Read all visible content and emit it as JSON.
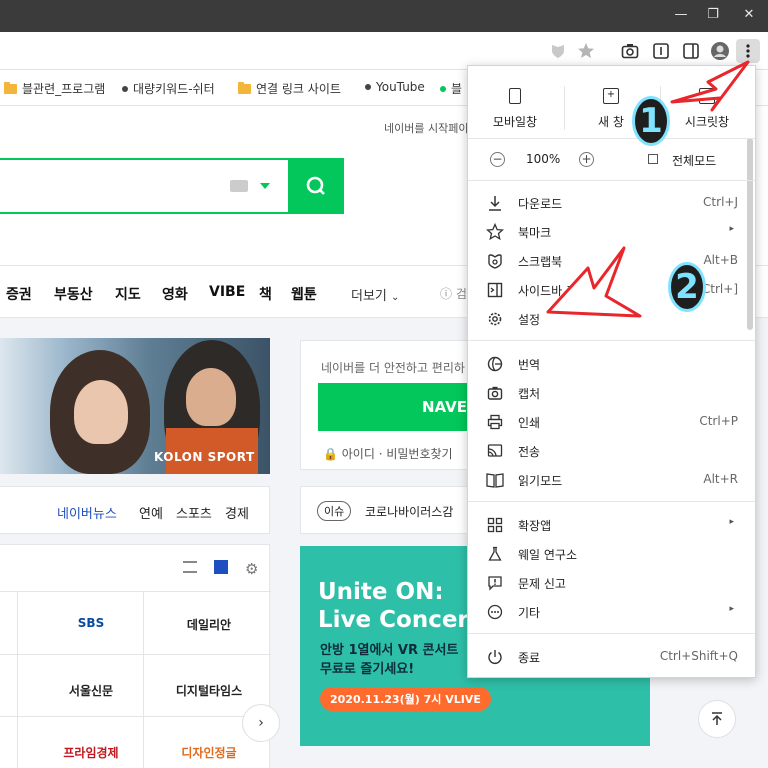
{
  "window": {
    "minimize": "—",
    "maximize": "❐",
    "close": "✕"
  },
  "bookmarks": [
    {
      "label": "블관련_프로그램",
      "type": "folder"
    },
    {
      "label": "대량키워드-쉬터",
      "type": "dot"
    },
    {
      "label": "연결 링크 사이트",
      "type": "folder"
    },
    {
      "label": "YouTube",
      "type": "dot"
    },
    {
      "label": "블",
      "type": "dot-green"
    }
  ],
  "page": {
    "start_text": "네이버를 시작페이",
    "nav": [
      "증권",
      "부동산",
      "지도",
      "영화",
      "VIBE",
      "책",
      "웹툰"
    ],
    "more": "더보기",
    "nav_tail": "검",
    "banner_brand": "KOLON SPORT",
    "login_hint": "네이버를 더 안전하고 편리하",
    "login_button": "NAVE",
    "login_id": "아이디",
    "login_pw": "비밀번호찾기",
    "news_tabs": [
      "네이버뉴스",
      "연예",
      "스포츠",
      "경제"
    ],
    "press": [
      "SBS",
      "데일리안",
      "서울신문",
      "디지털타임스",
      "프라임경제",
      "디자인정글"
    ],
    "issue_badge": "이슈",
    "issue_text": "코로나바이러스감",
    "ad_title": "Unite ON:\nLive Concer",
    "ad_sub": "안방 1열에서 VR 콘서트\n무료로 즐기세요!",
    "ad_pill": "2020.11.23(월) 7시 VLIVE"
  },
  "menu": {
    "top": [
      {
        "label": "모바일창"
      },
      {
        "label": "새 창"
      },
      {
        "label": "시크릿창"
      }
    ],
    "zoom": {
      "value": "100%",
      "minus": "−",
      "plus": "+",
      "fullscreen": "전체모드"
    },
    "group1": [
      {
        "label": "다운로드",
        "shortcut": "Ctrl+J",
        "icon": "download-icon"
      },
      {
        "label": "북마크",
        "shortcut": "",
        "arrow": "▸",
        "icon": "star-icon"
      },
      {
        "label": "스크랩북",
        "shortcut": "Alt+B",
        "icon": "scrapbook-icon"
      },
      {
        "label": "사이드바 표시",
        "shortcut": "Ctrl+]",
        "icon": "sidebar-icon"
      },
      {
        "label": "설정",
        "shortcut": "",
        "icon": "gear-icon"
      }
    ],
    "group2": [
      {
        "label": "번역",
        "shortcut": "",
        "icon": "translate-icon"
      },
      {
        "label": "캡처",
        "shortcut": "",
        "icon": "camera-icon"
      },
      {
        "label": "인쇄",
        "shortcut": "Ctrl+P",
        "icon": "print-icon"
      },
      {
        "label": "전송",
        "shortcut": "",
        "icon": "cast-icon"
      },
      {
        "label": "읽기모드",
        "shortcut": "Alt+R",
        "icon": "book-icon"
      }
    ],
    "group3": [
      {
        "label": "확장앱",
        "shortcut": "",
        "arrow": "▸",
        "icon": "extensions-icon"
      },
      {
        "label": "웨일 연구소",
        "shortcut": "",
        "icon": "flask-icon"
      },
      {
        "label": "문제 신고",
        "shortcut": "",
        "icon": "report-icon"
      },
      {
        "label": "기타",
        "shortcut": "",
        "arrow": "▸",
        "icon": "more-icon"
      }
    ],
    "quit": {
      "label": "종료",
      "shortcut": "Ctrl+Shift+Q",
      "icon": "power-icon"
    }
  },
  "annotations": {
    "badge1": "1",
    "badge2": "2"
  },
  "colors": {
    "accent": "#03c75a",
    "annotation_red": "#e8262b",
    "badge_cyan": "#7fe3ff"
  }
}
